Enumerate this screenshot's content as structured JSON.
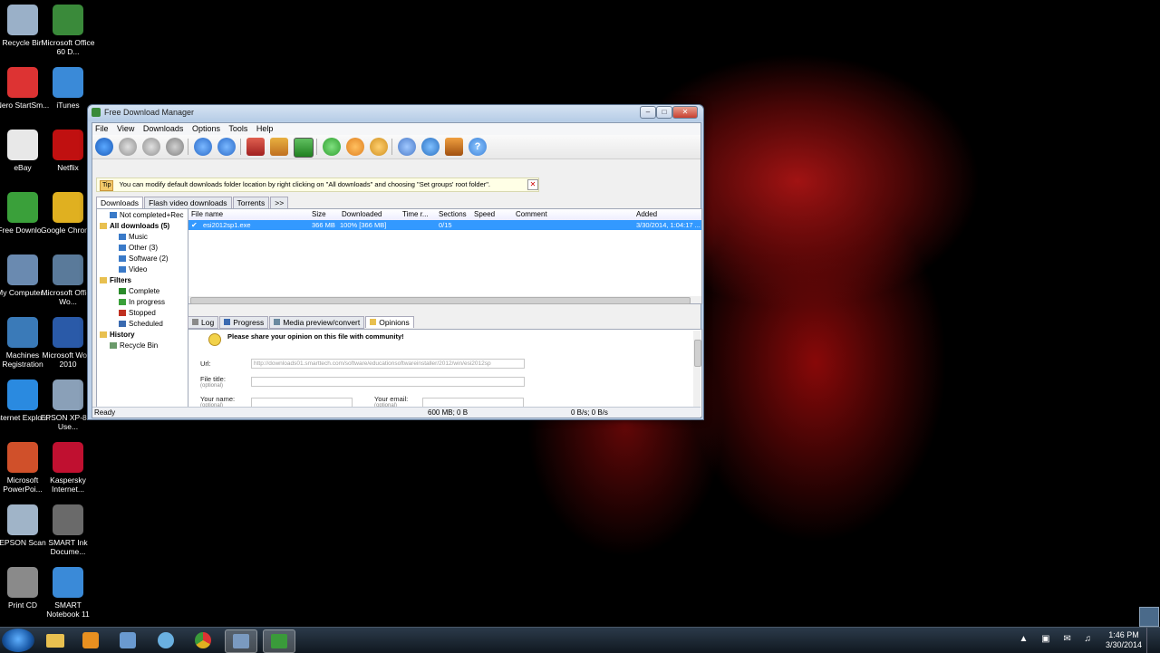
{
  "desktop": {
    "icons": [
      {
        "label": "Recycle Bin",
        "color": "#9ab0c8"
      },
      {
        "label": "Microsoft Office 60 D...",
        "color": "#3a8a3a"
      },
      {
        "label": "Nero StartSm...",
        "color": "#d33"
      },
      {
        "label": "iTunes",
        "color": "#3a8ad8"
      },
      {
        "label": "eBay",
        "color": "#e8e8e8"
      },
      {
        "label": "Netflix",
        "color": "#c01010"
      },
      {
        "label": "Free Downlo...",
        "color": "#3aa03a"
      },
      {
        "label": "Google Chrome",
        "color": "#e0b020"
      },
      {
        "label": "My Computer...",
        "color": "#6a8ab0"
      },
      {
        "label": "Microsoft Office Wo...",
        "color": "#5a7a9a"
      },
      {
        "label": "Machines Registration",
        "color": "#3a7ab8"
      },
      {
        "label": "Microsoft Word 2010",
        "color": "#2a5aa8"
      },
      {
        "label": "Internet Explorer",
        "color": "#2a8ae0"
      },
      {
        "label": "EPSON XP-810 Use...",
        "color": "#8aa0b8"
      },
      {
        "label": "Microsoft PowerPoi...",
        "color": "#d0502a"
      },
      {
        "label": "Kaspersky Internet...",
        "color": "#c01030"
      },
      {
        "label": "EPSON Scan",
        "color": "#a0b4c8"
      },
      {
        "label": "SMART Ink Docume...",
        "color": "#6a6a6a"
      },
      {
        "label": "Print CD",
        "color": "#8a8a8a"
      },
      {
        "label": "SMART Notebook 11",
        "color": "#3a8ad8"
      }
    ]
  },
  "window": {
    "title": "Free Download Manager",
    "menu": [
      "File",
      "View",
      "Downloads",
      "Options",
      "Tools",
      "Help"
    ],
    "tip_badge": "Tip",
    "tip_text": "You can modify default downloads folder location by right clicking on \"All downloads\" and choosing \"Set groups' root folder\".",
    "tabs": [
      "Downloads",
      "Flash video downloads",
      "Torrents",
      ">>"
    ],
    "tree": {
      "not_completed": "Not completed+Rec",
      "all_downloads": "All downloads (5)",
      "music": "Music",
      "other": "Other (3)",
      "software": "Software (2)",
      "video": "Video",
      "filters": "Filters",
      "complete": "Complete",
      "in_progress": "In progress",
      "stopped": "Stopped",
      "scheduled": "Scheduled",
      "history": "History",
      "recycle_bin": "Recycle Bin"
    },
    "columns": [
      "File name",
      "Size",
      "Downloaded",
      "Time r...",
      "Sections",
      "Speed",
      "Comment",
      "Added"
    ],
    "rows": [
      {
        "name": "esi2012sp1.exe",
        "size": "366 MB",
        "downloaded": "100% [366 MB]",
        "time": "",
        "sections": "0/15",
        "speed": "",
        "comment": "",
        "added": "3/30/2014, 1:04:17 ..."
      }
    ],
    "bottom_tabs": [
      "Log",
      "Progress",
      "Media preview/convert",
      "Opinions"
    ],
    "opinions": {
      "header": "Please share your opinion on this file with community!",
      "url_label": "Url:",
      "url_value": "http://downloads01.smarttech.com/software/educationsoftwareinstaller/2012/win/esi2012sp",
      "file_title_label": "File title:",
      "optional": "(optional)",
      "your_name_label": "Your name:",
      "your_email_label": "Your email:"
    },
    "status": {
      "left": "Ready",
      "middle": "600 MB; 0 B",
      "right": "0 B/s; 0 B/s"
    }
  },
  "taskbar": {
    "time": "1:46 PM",
    "date": "3/30/2014"
  }
}
